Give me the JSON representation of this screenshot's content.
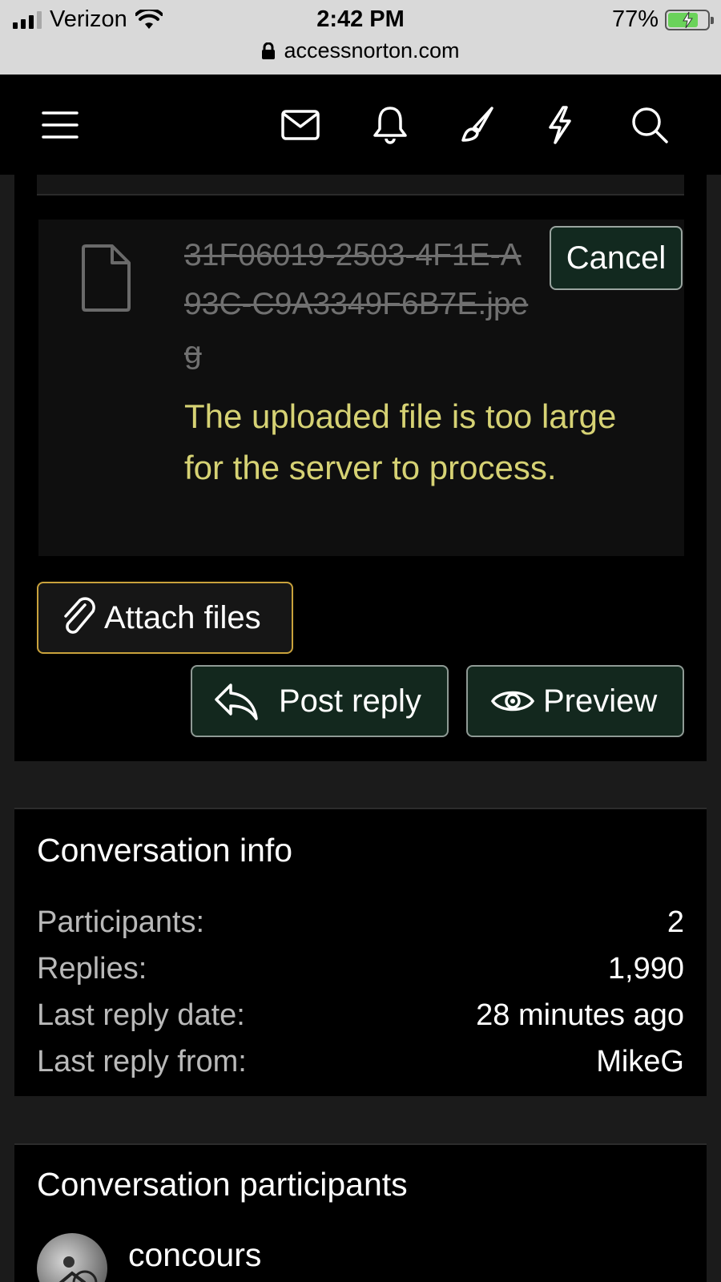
{
  "status_bar": {
    "carrier": "Verizon",
    "time": "2:42 PM",
    "battery": "77%",
    "url": "accessnorton.com"
  },
  "nav": {
    "icons": [
      "menu-icon",
      "mail-icon",
      "bell-icon",
      "brush-icon",
      "lightning-icon",
      "search-icon"
    ]
  },
  "upload": {
    "file_name": "31F06019-2503-4F1E-A93C-C9A3349F6B7E.jpeg",
    "error": "The uploaded file is too large for the server to process.",
    "cancel_label": "Cancel"
  },
  "actions": {
    "attach_label": "Attach files",
    "post_reply_label": "Post reply",
    "preview_label": "Preview"
  },
  "conversation_info": {
    "title": "Conversation info",
    "rows": [
      {
        "label": "Participants:",
        "value": "2"
      },
      {
        "label": "Replies:",
        "value": "1,990"
      },
      {
        "label": "Last reply date:",
        "value": "28 minutes ago"
      },
      {
        "label": "Last reply from:",
        "value": "MikeG"
      }
    ]
  },
  "participants": {
    "title": "Conversation participants",
    "items": [
      {
        "name": "concours"
      }
    ]
  },
  "colors": {
    "accent_gold": "#c9a23c",
    "button_green": "#13281e",
    "error_text": "#d6d274"
  }
}
